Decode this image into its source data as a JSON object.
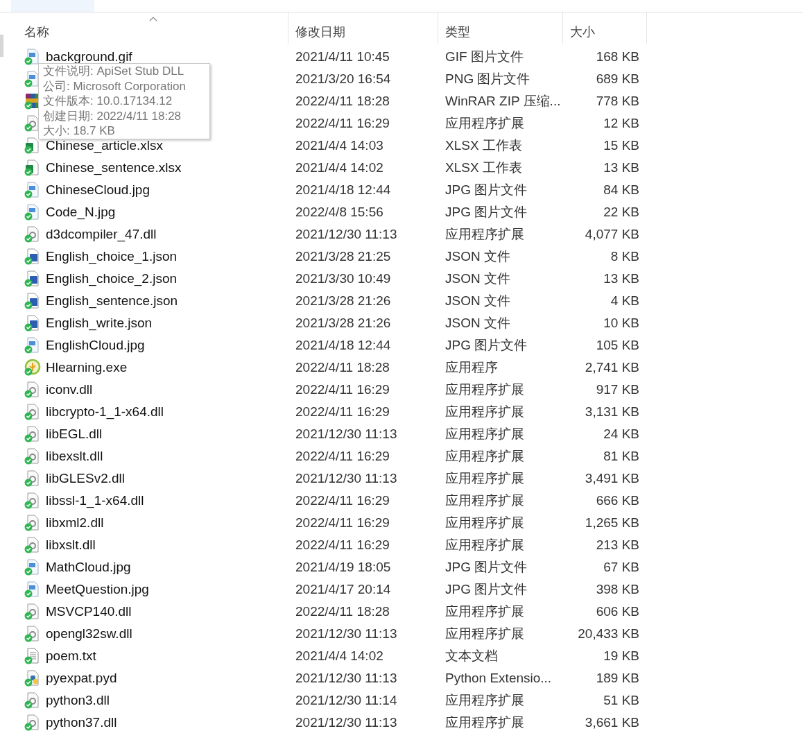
{
  "columns": [
    {
      "label": "名称",
      "sorted": true
    },
    {
      "label": "修改日期",
      "sorted": false
    },
    {
      "label": "类型",
      "sorted": false
    },
    {
      "label": "大小",
      "sorted": false
    }
  ],
  "rows": [
    {
      "kind": "image",
      "name": "background.gif",
      "date": "2021/4/11 10:45",
      "type": "GIF 图片文件",
      "size": "168 KB"
    },
    {
      "kind": "image",
      "date": "2021/3/20 16:54",
      "type": "PNG 图片文件",
      "size": "689 KB"
    },
    {
      "kind": "archive",
      "date": "2022/4/11 18:28",
      "type": "WinRAR ZIP 压缩...",
      "size": "778 KB"
    },
    {
      "kind": "dll",
      "date": "2022/4/11 16:29",
      "type": "应用程序扩展",
      "size": "12 KB"
    },
    {
      "kind": "sheet",
      "name": "Chinese_article.xlsx",
      "date": "2021/4/4 14:03",
      "type": "XLSX 工作表",
      "size": "15 KB"
    },
    {
      "kind": "sheet",
      "name": "Chinese_sentence.xlsx",
      "date": "2021/4/4 14:02",
      "type": "XLSX 工作表",
      "size": "13 KB"
    },
    {
      "kind": "image",
      "name": "ChineseCloud.jpg",
      "date": "2021/4/18 12:44",
      "type": "JPG 图片文件",
      "size": "84 KB"
    },
    {
      "kind": "image",
      "name": "Code_N.jpg",
      "date": "2022/4/8 15:56",
      "type": "JPG 图片文件",
      "size": "22 KB"
    },
    {
      "kind": "dll",
      "name": "d3dcompiler_47.dll",
      "date": "2021/12/30 11:13",
      "type": "应用程序扩展",
      "size": "4,077 KB"
    },
    {
      "kind": "json",
      "name": "English_choice_1.json",
      "date": "2021/3/28 21:25",
      "type": "JSON 文件",
      "size": "8 KB"
    },
    {
      "kind": "json",
      "name": "English_choice_2.json",
      "date": "2021/3/30 10:49",
      "type": "JSON 文件",
      "size": "13 KB"
    },
    {
      "kind": "json",
      "name": "English_sentence.json",
      "date": "2021/3/28 21:26",
      "type": "JSON 文件",
      "size": "4 KB"
    },
    {
      "kind": "json",
      "name": "English_write.json",
      "date": "2021/3/28 21:26",
      "type": "JSON 文件",
      "size": "10 KB"
    },
    {
      "kind": "image",
      "name": "EnglishCloud.jpg",
      "date": "2021/4/18 12:44",
      "type": "JPG 图片文件",
      "size": "105 KB"
    },
    {
      "kind": "exe",
      "name": "Hlearning.exe",
      "date": "2022/4/11 18:28",
      "type": "应用程序",
      "size": "2,741 KB"
    },
    {
      "kind": "dll",
      "name": "iconv.dll",
      "date": "2022/4/11 16:29",
      "type": "应用程序扩展",
      "size": "917 KB"
    },
    {
      "kind": "dll",
      "name": "libcrypto-1_1-x64.dll",
      "date": "2022/4/11 16:29",
      "type": "应用程序扩展",
      "size": "3,131 KB"
    },
    {
      "kind": "dll",
      "name": "libEGL.dll",
      "date": "2021/12/30 11:13",
      "type": "应用程序扩展",
      "size": "24 KB"
    },
    {
      "kind": "dll",
      "name": "libexslt.dll",
      "date": "2022/4/11 16:29",
      "type": "应用程序扩展",
      "size": "81 KB"
    },
    {
      "kind": "dll",
      "name": "libGLESv2.dll",
      "date": "2021/12/30 11:13",
      "type": "应用程序扩展",
      "size": "3,491 KB"
    },
    {
      "kind": "dll",
      "name": "libssl-1_1-x64.dll",
      "date": "2022/4/11 16:29",
      "type": "应用程序扩展",
      "size": "666 KB"
    },
    {
      "kind": "dll",
      "name": "libxml2.dll",
      "date": "2022/4/11 16:29",
      "type": "应用程序扩展",
      "size": "1,265 KB"
    },
    {
      "kind": "dll",
      "name": "libxslt.dll",
      "date": "2022/4/11 16:29",
      "type": "应用程序扩展",
      "size": "213 KB"
    },
    {
      "kind": "image",
      "name": "MathCloud.jpg",
      "date": "2021/4/19 18:05",
      "type": "JPG 图片文件",
      "size": "67 KB"
    },
    {
      "kind": "image",
      "name": "MeetQuestion.jpg",
      "date": "2021/4/17 20:14",
      "type": "JPG 图片文件",
      "size": "398 KB"
    },
    {
      "kind": "dll",
      "name": "MSVCP140.dll",
      "date": "2022/4/11 18:28",
      "type": "应用程序扩展",
      "size": "606 KB"
    },
    {
      "kind": "dll",
      "name": "opengl32sw.dll",
      "date": "2021/12/30 11:13",
      "type": "应用程序扩展",
      "size": "20,433 KB"
    },
    {
      "kind": "text",
      "name": "poem.txt",
      "date": "2021/4/4 14:02",
      "type": "文本文档",
      "size": "19 KB"
    },
    {
      "kind": "python",
      "name": "pyexpat.pyd",
      "date": "2021/12/30 11:13",
      "type": "Python Extensio...",
      "size": "189 KB"
    },
    {
      "kind": "dll",
      "name": "python3.dll",
      "date": "2021/12/30 11:14",
      "type": "应用程序扩展",
      "size": "51 KB"
    },
    {
      "kind": "dll",
      "name": "python37.dll",
      "date": "2021/12/30 11:13",
      "type": "应用程序扩展",
      "size": "3,661 KB"
    }
  ],
  "tooltip": {
    "lines": [
      "文件说明: ApiSet Stub DLL",
      "公司: Microsoft Corporation",
      "文件版本: 10.0.17134.12",
      "创建日期: 2022/4/11 18:28",
      "大小: 18.7 KB"
    ]
  }
}
